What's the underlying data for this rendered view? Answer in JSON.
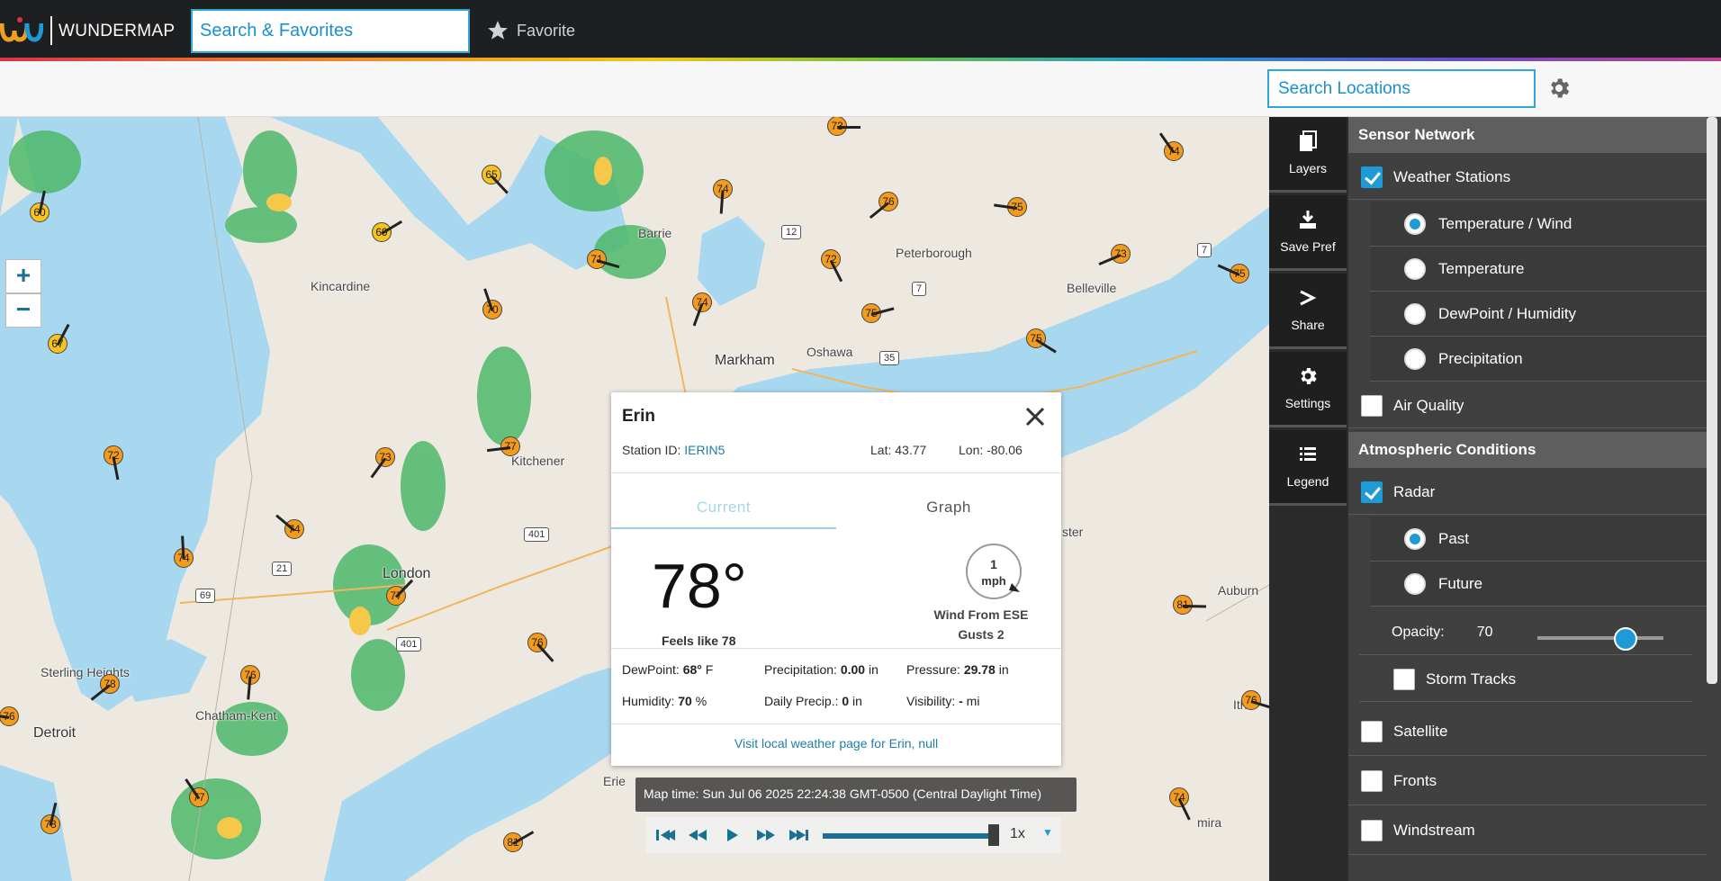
{
  "topbar": {
    "brand": "WUNDERMAP",
    "search_placeholder": "Search & Favorites",
    "favorite_label": "Favorite"
  },
  "subbar": {
    "search_locations_placeholder": "Search Locations",
    "settings_icon": "gear-icon"
  },
  "map": {
    "cities": [
      "Kincardine",
      "Barrie",
      "Peterborough",
      "Belleville",
      "Markham",
      "Oshawa",
      "Kitchener",
      "London",
      "Sterling Heights",
      "Detroit",
      "Chatham-Kent",
      "Erie",
      "Auburn",
      "ster",
      "Ith",
      "mira"
    ],
    "zoom_in": "+",
    "zoom_out": "−",
    "stations": [
      "73",
      "65",
      "74",
      "76",
      "75",
      "74",
      "60",
      "69",
      "71",
      "72",
      "74",
      "73",
      "75",
      "70",
      "67",
      "75",
      "75",
      "72",
      "73",
      "77",
      "74",
      "74",
      "77",
      "81",
      "76",
      "76",
      "78",
      "76",
      "77",
      "78",
      "81",
      "76",
      "74"
    ],
    "highway_shields": [
      "12",
      "7",
      "35",
      "21",
      "401",
      "401",
      "69",
      "7"
    ]
  },
  "popup": {
    "title": "Erin",
    "station_label": "Station ID:",
    "station_id": "IERIN5",
    "lat": "Lat: 43.77",
    "lon": "Lon: -80.06",
    "tab_current": "Current",
    "tab_graph": "Graph",
    "temperature": "78°",
    "feels_like": "Feels like 78",
    "wind_speed": "1",
    "wind_unit": "mph",
    "wind_from": "Wind From ESE",
    "gusts": "Gusts 2",
    "dewpoint_label": "DewPoint:",
    "dewpoint_value": "68°",
    "dewpoint_unit": "F",
    "precip_label": "Precipitation:",
    "precip_value": "0.00",
    "precip_unit": "in",
    "pressure_label": "Pressure:",
    "pressure_value": "29.78",
    "pressure_unit": "in",
    "humidity_label": "Humidity:",
    "humidity_value": "70",
    "humidity_unit": "%",
    "daily_precip_label": "Daily Precip.:",
    "daily_precip_value": "0",
    "daily_precip_unit": "in",
    "visibility_label": "Visibility:",
    "visibility_value": "-",
    "visibility_unit": "mi",
    "visit_link": "Visit local weather page for Erin, null"
  },
  "playback": {
    "map_time": "Map time: Sun Jul 06 2025 22:24:38 GMT-0500 (Central Daylight Time)",
    "speed": "1x"
  },
  "sidenav": [
    {
      "label": "Layers",
      "icon": "layers-icon"
    },
    {
      "label": "Save Pref",
      "icon": "download-icon"
    },
    {
      "label": "Share",
      "icon": "share-icon"
    },
    {
      "label": "Settings",
      "icon": "gear-icon"
    },
    {
      "label": "Legend",
      "icon": "list-icon"
    }
  ],
  "panel": {
    "sensor_network": "Sensor Network",
    "weather_stations": "Weather Stations",
    "temp_wind": "Temperature / Wind",
    "temperature": "Temperature",
    "dewpoint_humidity": "DewPoint / Humidity",
    "precipitation": "Precipitation",
    "air_quality": "Air Quality",
    "atmospheric": "Atmospheric Conditions",
    "radar": "Radar",
    "past": "Past",
    "future": "Future",
    "opacity_label": "Opacity:",
    "opacity_value": "70",
    "storm_tracks": "Storm Tracks",
    "satellite": "Satellite",
    "fronts": "Fronts",
    "windstream": "Windstream",
    "colors": {
      "accent": "#1e9ad6",
      "station_yellow": "#f8c21f",
      "station_orange": "#f39b1d"
    }
  }
}
